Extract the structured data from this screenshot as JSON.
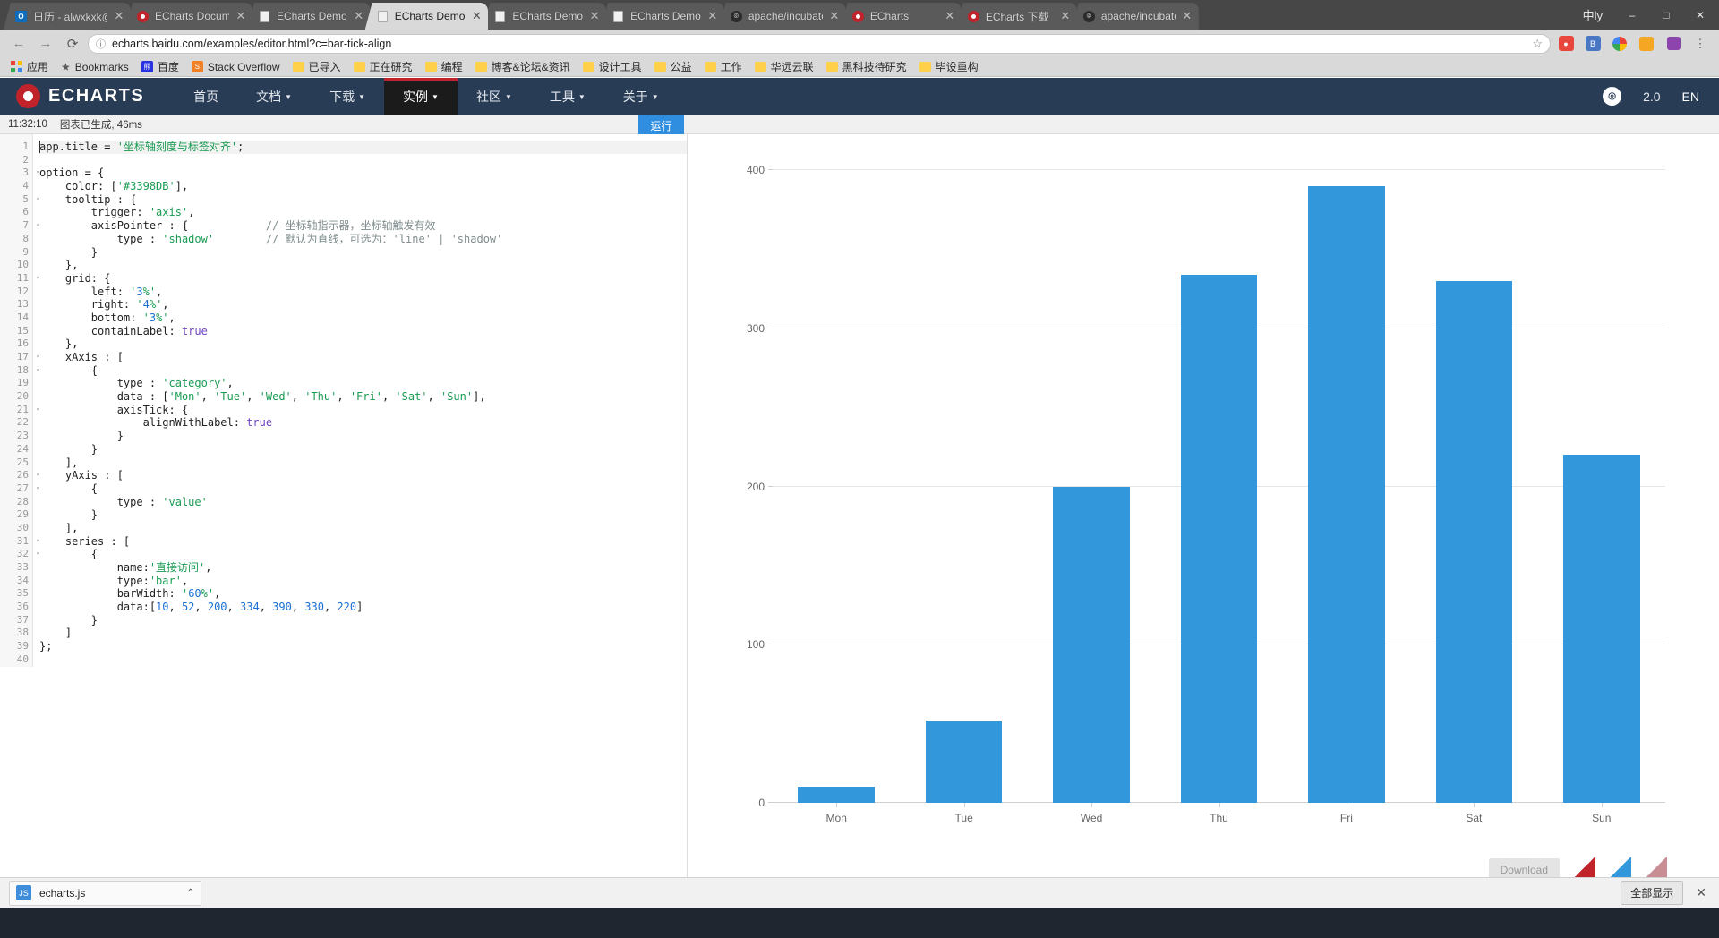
{
  "window": {
    "ime_label": "中ly",
    "minimize": "–",
    "maximize": "□",
    "close": "✕"
  },
  "tabs": [
    {
      "title": "日历 - alwxkxk@ou",
      "favicon": "outlook-icon",
      "active": false,
      "close": "✕"
    },
    {
      "title": "ECharts Documenta",
      "favicon": "echarts-icon",
      "active": false,
      "close": "✕"
    },
    {
      "title": "ECharts Demo",
      "favicon": "document-icon",
      "active": false,
      "close": "✕"
    },
    {
      "title": "ECharts Demo",
      "favicon": "document-icon",
      "active": true,
      "close": "✕"
    },
    {
      "title": "ECharts Demo",
      "favicon": "document-icon",
      "active": false,
      "close": "✕"
    },
    {
      "title": "ECharts Demo",
      "favicon": "document-icon",
      "active": false,
      "close": "✕"
    },
    {
      "title": "apache/incubator-e",
      "favicon": "github-icon",
      "active": false,
      "close": "✕"
    },
    {
      "title": "ECharts",
      "favicon": "echarts-icon",
      "active": false,
      "close": "✕"
    },
    {
      "title": "ECharts 下载",
      "favicon": "echarts-icon",
      "active": false,
      "close": "✕"
    },
    {
      "title": "apache/incubator-e",
      "favicon": "github-icon",
      "active": false,
      "close": "✕"
    }
  ],
  "toolbar": {
    "back": "←",
    "forward": "→",
    "reload": "⟳",
    "url": "echarts.baidu.com/examples/editor.html?c=bar-tick-align",
    "info_icon": "ⓘ",
    "star_icon": "☆",
    "menu_icon": "⋮"
  },
  "bookmarks": [
    {
      "label": "应用",
      "icon": "apps-grid-icon"
    },
    {
      "label": "Bookmarks",
      "icon": "star-icon"
    },
    {
      "label": "百度",
      "icon": "baidu-icon"
    },
    {
      "label": "Stack Overflow",
      "icon": "stackoverflow-icon"
    },
    {
      "label": "已导入",
      "icon": "folder-icon"
    },
    {
      "label": "正在研究",
      "icon": "folder-icon"
    },
    {
      "label": "编程",
      "icon": "folder-icon"
    },
    {
      "label": "博客&论坛&资讯",
      "icon": "folder-icon"
    },
    {
      "label": "设计工具",
      "icon": "folder-icon"
    },
    {
      "label": "公益",
      "icon": "folder-icon"
    },
    {
      "label": "工作",
      "icon": "folder-icon"
    },
    {
      "label": "华远云联",
      "icon": "folder-icon"
    },
    {
      "label": "黑科技待研究",
      "icon": "folder-icon"
    },
    {
      "label": "毕设重构",
      "icon": "folder-icon"
    }
  ],
  "site_nav": {
    "brand": "ECHARTS",
    "items": [
      {
        "label": "首页",
        "has_caret": false,
        "active": false
      },
      {
        "label": "文档",
        "has_caret": true,
        "active": false
      },
      {
        "label": "下载",
        "has_caret": true,
        "active": false
      },
      {
        "label": "实例",
        "has_caret": true,
        "active": true
      },
      {
        "label": "社区",
        "has_caret": true,
        "active": false
      },
      {
        "label": "工具",
        "has_caret": true,
        "active": false
      },
      {
        "label": "关于",
        "has_caret": true,
        "active": false
      }
    ],
    "github_icon": "github-icon",
    "version": "2.0",
    "language": "EN"
  },
  "status": {
    "time": "11:32:10",
    "message": "图表已生成, 46ms",
    "run_button": "运行"
  },
  "editor": {
    "caret_line": 1,
    "lines": [
      {
        "n": 1,
        "fold": false,
        "text": "app.title = '坐标轴刻度与标签对齐';"
      },
      {
        "n": 2,
        "fold": false,
        "text": ""
      },
      {
        "n": 3,
        "fold": true,
        "text": "option = {"
      },
      {
        "n": 4,
        "fold": false,
        "text": "    color: ['#3398DB'],"
      },
      {
        "n": 5,
        "fold": true,
        "text": "    tooltip : {"
      },
      {
        "n": 6,
        "fold": false,
        "text": "        trigger: 'axis',"
      },
      {
        "n": 7,
        "fold": true,
        "text": "        axisPointer : {            // 坐标轴指示器，坐标轴触发有效"
      },
      {
        "n": 8,
        "fold": false,
        "text": "            type : 'shadow'        // 默认为直线，可选为：'line' | 'shadow'"
      },
      {
        "n": 9,
        "fold": false,
        "text": "        }"
      },
      {
        "n": 10,
        "fold": false,
        "text": "    },"
      },
      {
        "n": 11,
        "fold": true,
        "text": "    grid: {"
      },
      {
        "n": 12,
        "fold": false,
        "text": "        left: '3%',"
      },
      {
        "n": 13,
        "fold": false,
        "text": "        right: '4%',"
      },
      {
        "n": 14,
        "fold": false,
        "text": "        bottom: '3%',"
      },
      {
        "n": 15,
        "fold": false,
        "text": "        containLabel: true"
      },
      {
        "n": 16,
        "fold": false,
        "text": "    },"
      },
      {
        "n": 17,
        "fold": true,
        "text": "    xAxis : ["
      },
      {
        "n": 18,
        "fold": true,
        "text": "        {"
      },
      {
        "n": 19,
        "fold": false,
        "text": "            type : 'category',"
      },
      {
        "n": 20,
        "fold": false,
        "text": "            data : ['Mon', 'Tue', 'Wed', 'Thu', 'Fri', 'Sat', 'Sun'],"
      },
      {
        "n": 21,
        "fold": true,
        "text": "            axisTick: {"
      },
      {
        "n": 22,
        "fold": false,
        "text": "                alignWithLabel: true"
      },
      {
        "n": 23,
        "fold": false,
        "text": "            }"
      },
      {
        "n": 24,
        "fold": false,
        "text": "        }"
      },
      {
        "n": 25,
        "fold": false,
        "text": "    ],"
      },
      {
        "n": 26,
        "fold": true,
        "text": "    yAxis : ["
      },
      {
        "n": 27,
        "fold": true,
        "text": "        {"
      },
      {
        "n": 28,
        "fold": false,
        "text": "            type : 'value'"
      },
      {
        "n": 29,
        "fold": false,
        "text": "        }"
      },
      {
        "n": 30,
        "fold": false,
        "text": "    ],"
      },
      {
        "n": 31,
        "fold": true,
        "text": "    series : ["
      },
      {
        "n": 32,
        "fold": true,
        "text": "        {"
      },
      {
        "n": 33,
        "fold": false,
        "text": "            name:'直接访问',"
      },
      {
        "n": 34,
        "fold": false,
        "text": "            type:'bar',"
      },
      {
        "n": 35,
        "fold": false,
        "text": "            barWidth: '60%',"
      },
      {
        "n": 36,
        "fold": false,
        "text": "            data:[10, 52, 200, 334, 390, 330, 220]"
      },
      {
        "n": 37,
        "fold": false,
        "text": "        }"
      },
      {
        "n": 38,
        "fold": false,
        "text": "    ]"
      },
      {
        "n": 39,
        "fold": false,
        "text": "};"
      },
      {
        "n": 40,
        "fold": false,
        "text": ""
      }
    ]
  },
  "chart_data": {
    "type": "bar",
    "title": "",
    "categories": [
      "Mon",
      "Tue",
      "Wed",
      "Thu",
      "Fri",
      "Sat",
      "Sun"
    ],
    "series": [
      {
        "name": "直接访问",
        "values": [
          10,
          52,
          200,
          334,
          390,
          330,
          220
        ],
        "color": "#3398DB"
      }
    ],
    "yticks": [
      0,
      100,
      200,
      300,
      400
    ],
    "ylim": [
      0,
      400
    ],
    "xlabel": "",
    "ylabel": "",
    "grid": true,
    "legend": "none",
    "bar_width_pct": 60
  },
  "chart_tools": {
    "download_label": "Download",
    "themes": [
      "theme-red-swatch",
      "theme-blue-swatch",
      "theme-rose-swatch"
    ]
  },
  "download_shelf": {
    "file_name": "echarts.js",
    "file_icon": "js-file-icon",
    "caret": "⌃",
    "show_all": "全部显示",
    "close": "✕"
  }
}
